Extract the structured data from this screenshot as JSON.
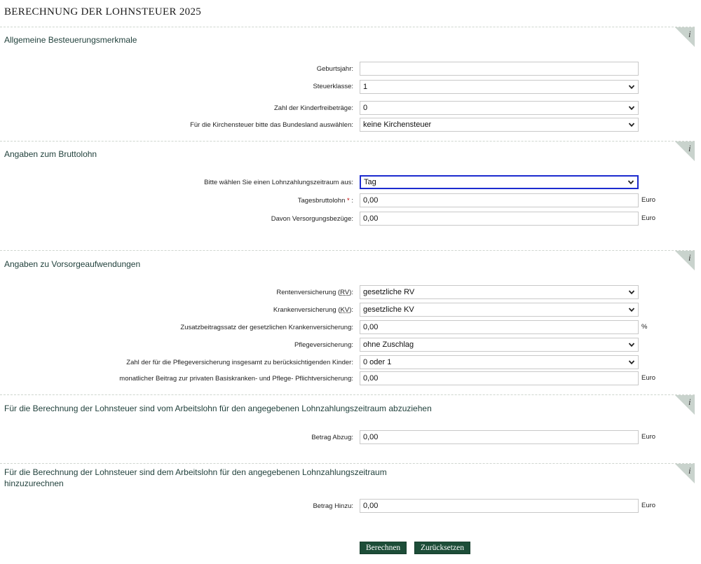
{
  "page": {
    "title": "BERECHNUNG DER LOHNSTEUER 2025"
  },
  "sections": {
    "allgemein": {
      "title": "Allgemeine Besteuerungsmerkmale"
    },
    "brutto": {
      "title": "Angaben zum Bruttolohn"
    },
    "vorsorge": {
      "title": "Angaben zu Vorsorgeaufwendungen"
    },
    "abzug": {
      "title": "Für die Berechnung der Lohnsteuer sind vom Arbeitslohn für den angegebenen Lohnzahlungszeitraum abzuziehen"
    },
    "hinzu": {
      "title_line1": "Für die Berechnung der Lohnsteuer sind dem Arbeitslohn für den angegebenen Lohnzahlungszeitraum",
      "title_line2": "hinzuzurechnen"
    }
  },
  "info_icon": {
    "glyph": "i",
    "icon": "info-icon"
  },
  "fields": {
    "geburtsjahr": {
      "label": "Geburtsjahr:",
      "value": ""
    },
    "steuerklasse": {
      "label": "Steuerklasse:",
      "value": "1"
    },
    "kinderfreibetraege": {
      "label": "Zahl der Kinderfreibeträge:",
      "value": "0"
    },
    "kirchensteuer": {
      "label": "Für die Kirchensteuer bitte das Bundesland auswählen:",
      "value": "keine Kirchensteuer"
    },
    "zeitraum": {
      "label": "Bitte wählen Sie einen Lohnzahlungszeitraum aus:",
      "value": "Tag"
    },
    "tagesbrutto": {
      "label": "Tagesbruttolohn",
      "required_mark": "*",
      "suffix": ":",
      "value": "0,00",
      "unit": "Euro"
    },
    "versorgungsbezuege": {
      "label": "Davon Versorgungsbezüge:",
      "value": "0,00",
      "unit": "Euro"
    },
    "rv": {
      "label_prefix": "Rentenversicherung (",
      "label_abbr": "RV",
      "label_suffix": "):",
      "value": "gesetzliche RV"
    },
    "kv": {
      "label_prefix": "Krankenversicherung (",
      "label_abbr": "KV",
      "label_suffix": "):",
      "value": "gesetzliche KV"
    },
    "zusatzbeitrag": {
      "label": "Zusatzbeitragssatz der gesetzlichen Krankenversicherung:",
      "value": "0,00",
      "unit": "%"
    },
    "pflege": {
      "label": "Pflegeversicherung:",
      "value": "ohne Zuschlag"
    },
    "pflege_kinder": {
      "label": "Zahl der für die Pflegeversicherung insgesamt zu berücksichtigenden Kinder:",
      "value": "0 oder 1"
    },
    "basis_beitrag": {
      "label": "monatlicher Beitrag zur privaten Basiskranken- und Pflege- Pflichtversicherung:",
      "value": "0,00",
      "unit": "Euro"
    },
    "betrag_abzug": {
      "label": "Betrag Abzug:",
      "value": "0,00",
      "unit": "Euro"
    },
    "betrag_hinzu": {
      "label": "Betrag Hinzu:",
      "value": "0,00",
      "unit": "Euro"
    }
  },
  "buttons": {
    "berechnen": "Berechnen",
    "zuruecksetzen": "Zurücksetzen"
  },
  "colors": {
    "accent": "#1d4d38",
    "focus": "#1c2bcf",
    "section_title": "#1f3f3a",
    "info_tab": "#c9d3cd"
  }
}
